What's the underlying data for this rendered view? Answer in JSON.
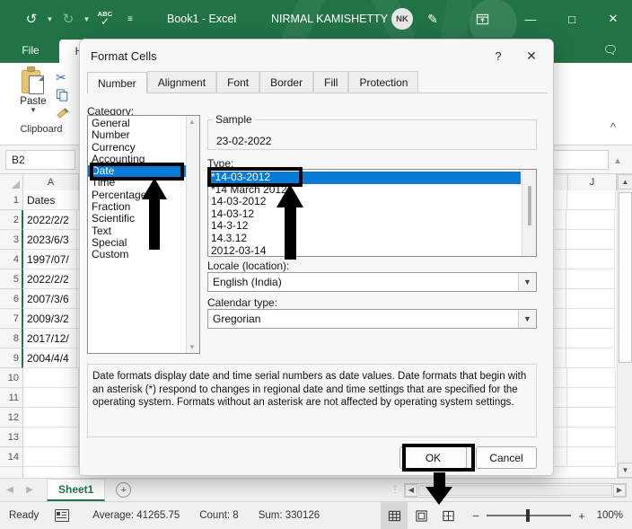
{
  "titlebar": {
    "undo_icon": "undo-icon",
    "redo_icon": "redo-icon",
    "spellcheck_icon": "spellcheck-icon",
    "abc_label": "ABC",
    "customize_icon": "customize-quick-access-icon",
    "document_title": "Book1  -  Excel",
    "account_name": "NIRMAL KAMISHETTY",
    "avatar_initials": "NK",
    "ribbon_display_icon": "ribbon-display-options-icon",
    "minimize_icon": "minimize-icon",
    "maximize_icon": "maximize-icon",
    "close_icon": "close-icon"
  },
  "ribbon": {
    "tabs": [
      {
        "label": "File"
      },
      {
        "label": "H"
      }
    ],
    "comment_icon": "comment-icon",
    "collapse_icon": "collapse-ribbon-icon",
    "clipboard": {
      "paste_label": "Paste",
      "group_label": "Clipboard",
      "cut_icon": "cut-icon",
      "copy_icon": "copy-icon",
      "format_painter_icon": "format-painter-icon"
    }
  },
  "formula_bar": {
    "name_box_value": "B2",
    "formula_value": "",
    "expand_icon": "expand-formula-bar-icon"
  },
  "grid": {
    "columns": [
      "A",
      "J"
    ],
    "rows": [
      "1",
      "2",
      "3",
      "4",
      "5",
      "6",
      "7",
      "8",
      "9",
      "10",
      "11",
      "12",
      "13",
      "14"
    ],
    "cells_a": [
      "Dates",
      "2022/2/2",
      "2023/6/3",
      "1997/07/",
      "2022/2/2",
      "2007/3/6",
      "2009/3/2",
      "2017/12/",
      "2004/4/4",
      "",
      "",
      "",
      "",
      ""
    ],
    "vscroll_up_icon": "scroll-up-icon",
    "vscroll_down_icon": "scroll-down-icon"
  },
  "sheet_tabs": {
    "prev_icon": "previous-sheet-icon",
    "next_icon": "next-sheet-icon",
    "sheet_name": "Sheet1",
    "add_sheet_icon": "add-sheet-icon",
    "hscroll_left_icon": "scroll-left-icon",
    "hscroll_right_icon": "scroll-right-icon"
  },
  "status_bar": {
    "mode": "Ready",
    "macro_icon": "record-macro-icon",
    "average": "Average: 41265.75",
    "count": "Count: 8",
    "sum": "Sum: 330126",
    "view_normal_icon": "normal-view-icon",
    "view_pagelayout_icon": "page-layout-view-icon",
    "view_pagebreak_icon": "page-break-preview-icon",
    "zoom_out_icon": "zoom-out-icon",
    "zoom_in_icon": "zoom-in-icon",
    "zoom_level": "100%"
  },
  "dialog": {
    "title": "Format Cells",
    "help_icon": "help-icon",
    "close_icon": "close-icon",
    "tabs": [
      {
        "label": "Number",
        "active": true
      },
      {
        "label": "Alignment",
        "active": false
      },
      {
        "label": "Font",
        "active": false
      },
      {
        "label": "Border",
        "active": false
      },
      {
        "label": "Fill",
        "active": false
      },
      {
        "label": "Protection",
        "active": false
      }
    ],
    "category_label": "Category:",
    "categories": [
      "General",
      "Number",
      "Currency",
      "Accounting",
      "Date",
      "Time",
      "Percentage",
      "Fraction",
      "Scientific",
      "Text",
      "Special",
      "Custom"
    ],
    "selected_category": "Date",
    "sample_label": "Sample",
    "sample_value": "23-02-2022",
    "type_label": "Type:",
    "types": [
      "*14-03-2012",
      "*14 March 2012",
      "14-03-2012",
      "14-03-12",
      "14-3-12",
      "14.3.12",
      "2012-03-14"
    ],
    "selected_type": "*14-03-2012",
    "locale_label": "Locale (location):",
    "locale_value": "English (India)",
    "calendar_label": "Calendar type:",
    "calendar_value": "Gregorian",
    "description": "Date formats display date and time serial numbers as date values.  Date formats that begin with an asterisk (*) respond to changes in regional date and time settings that are specified for the operating system. Formats without an asterisk are not affected by operating system settings.",
    "ok_label": "OK",
    "cancel_label": "Cancel"
  },
  "annotations": {
    "highlight_color": "#000000",
    "targets": [
      "Date category",
      "*14-03-2012 type",
      "OK button"
    ]
  },
  "colors": {
    "excel_green": "#217346",
    "selection_blue": "#0a7bd4",
    "dialog_bg": "#f7f7f7"
  }
}
